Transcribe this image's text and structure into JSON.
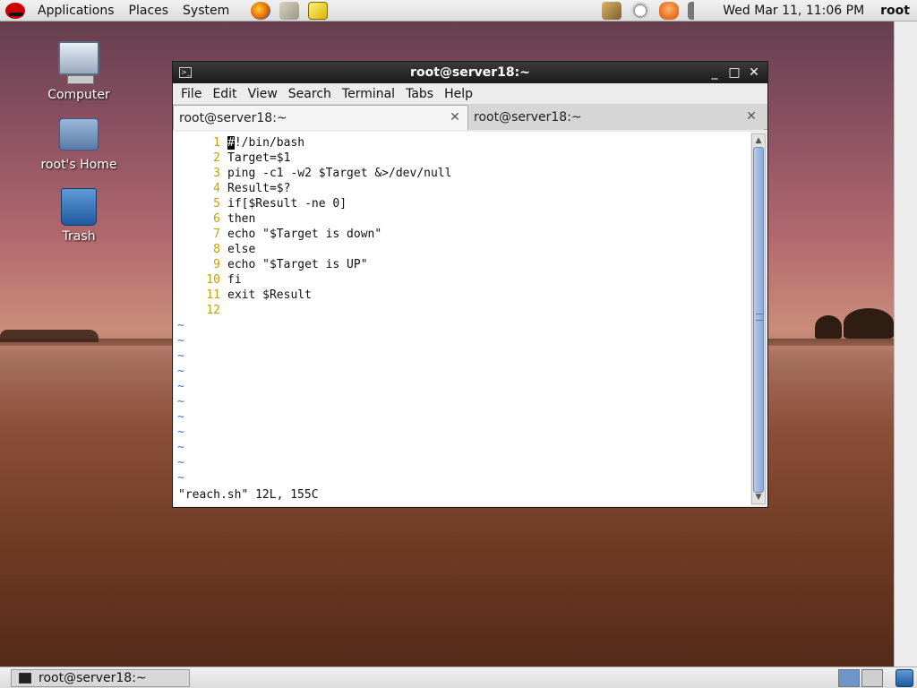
{
  "top_panel": {
    "menus": [
      "Applications",
      "Places",
      "System"
    ],
    "launchers": [
      "firefox-icon",
      "mail-icon",
      "notes-icon"
    ],
    "clock": "Wed Mar 11, 11:06 PM",
    "user": "root"
  },
  "desktop_icons": [
    {
      "label": "Computer",
      "icon": "computer-icon"
    },
    {
      "label": "root's Home",
      "icon": "home-folder-icon"
    },
    {
      "label": "Trash",
      "icon": "trash-icon"
    }
  ],
  "terminal": {
    "title": "root@server18:~",
    "window_controls": {
      "minimize": "_",
      "maximize": "□",
      "close": "✕"
    },
    "menu": [
      "File",
      "Edit",
      "View",
      "Search",
      "Terminal",
      "Tabs",
      "Help"
    ],
    "tabs": [
      {
        "label": "root@server18:~",
        "active": true
      },
      {
        "label": "root@server18:~",
        "active": false
      }
    ],
    "lines": [
      {
        "num": "1",
        "cursor": "#",
        "text": "!/bin/bash"
      },
      {
        "num": "2",
        "text": "Target=$1"
      },
      {
        "num": "3",
        "text": "ping -c1 -w2 $Target &>/dev/null"
      },
      {
        "num": "4",
        "text": "Result=$?"
      },
      {
        "num": "5",
        "text": "if[$Result -ne 0]"
      },
      {
        "num": "6",
        "text": "then"
      },
      {
        "num": "7",
        "text": "echo \"$Target is down\""
      },
      {
        "num": "8",
        "text": "else"
      },
      {
        "num": "9",
        "text": "echo \"$Target is UP\""
      },
      {
        "num": "10",
        "text": "fi"
      },
      {
        "num": "11",
        "text": "exit $Result"
      },
      {
        "num": "12",
        "text": ""
      }
    ],
    "tilde_rows": [
      "~",
      "~",
      "~",
      "~",
      "~",
      "~",
      "~",
      "~",
      "~",
      "~",
      "~"
    ],
    "status_line": "\"reach.sh\" 12L, 155C"
  },
  "bottom_panel": {
    "task": "root@server18:~",
    "workspaces": [
      "1",
      "2"
    ]
  }
}
